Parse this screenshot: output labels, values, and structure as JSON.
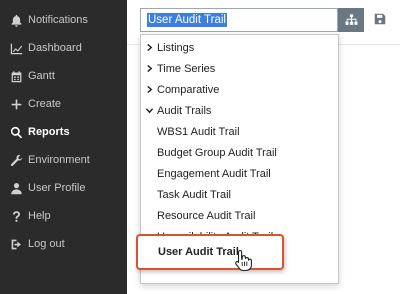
{
  "sidebar": {
    "items": [
      {
        "label": "Notifications",
        "icon": "bell-icon"
      },
      {
        "label": "Dashboard",
        "icon": "chart-line-icon"
      },
      {
        "label": "Gantt",
        "icon": "calendar-icon"
      },
      {
        "label": "Create",
        "icon": "plus-icon"
      },
      {
        "label": "Reports",
        "icon": "search-icon",
        "active": true
      },
      {
        "label": "Environment",
        "icon": "wrench-icon"
      },
      {
        "label": "User Profile",
        "icon": "user-icon"
      },
      {
        "label": "Help",
        "icon": "question-icon"
      },
      {
        "label": "Log out",
        "icon": "logout-icon"
      }
    ]
  },
  "search": {
    "value": "User Audit Trail"
  },
  "dropdown": {
    "groups": [
      {
        "label": "Listings",
        "expanded": false
      },
      {
        "label": "Time Series",
        "expanded": false
      },
      {
        "label": "Comparative",
        "expanded": false
      },
      {
        "label": "Audit Trails",
        "expanded": true
      }
    ],
    "children": [
      "WBS1 Audit Trail",
      "Budget Group Audit Trail",
      "Engagement Audit Trail",
      "Task Audit Trail",
      "Resource Audit Trail",
      "Unavailability Audit Trail"
    ],
    "selected": "User Audit Trail"
  },
  "colors": {
    "sidebar_bg": "#2b2b2b",
    "selection_bg": "#3d7fe0",
    "highlight_border": "#d9532f",
    "tree_button_bg": "#6b7884"
  }
}
